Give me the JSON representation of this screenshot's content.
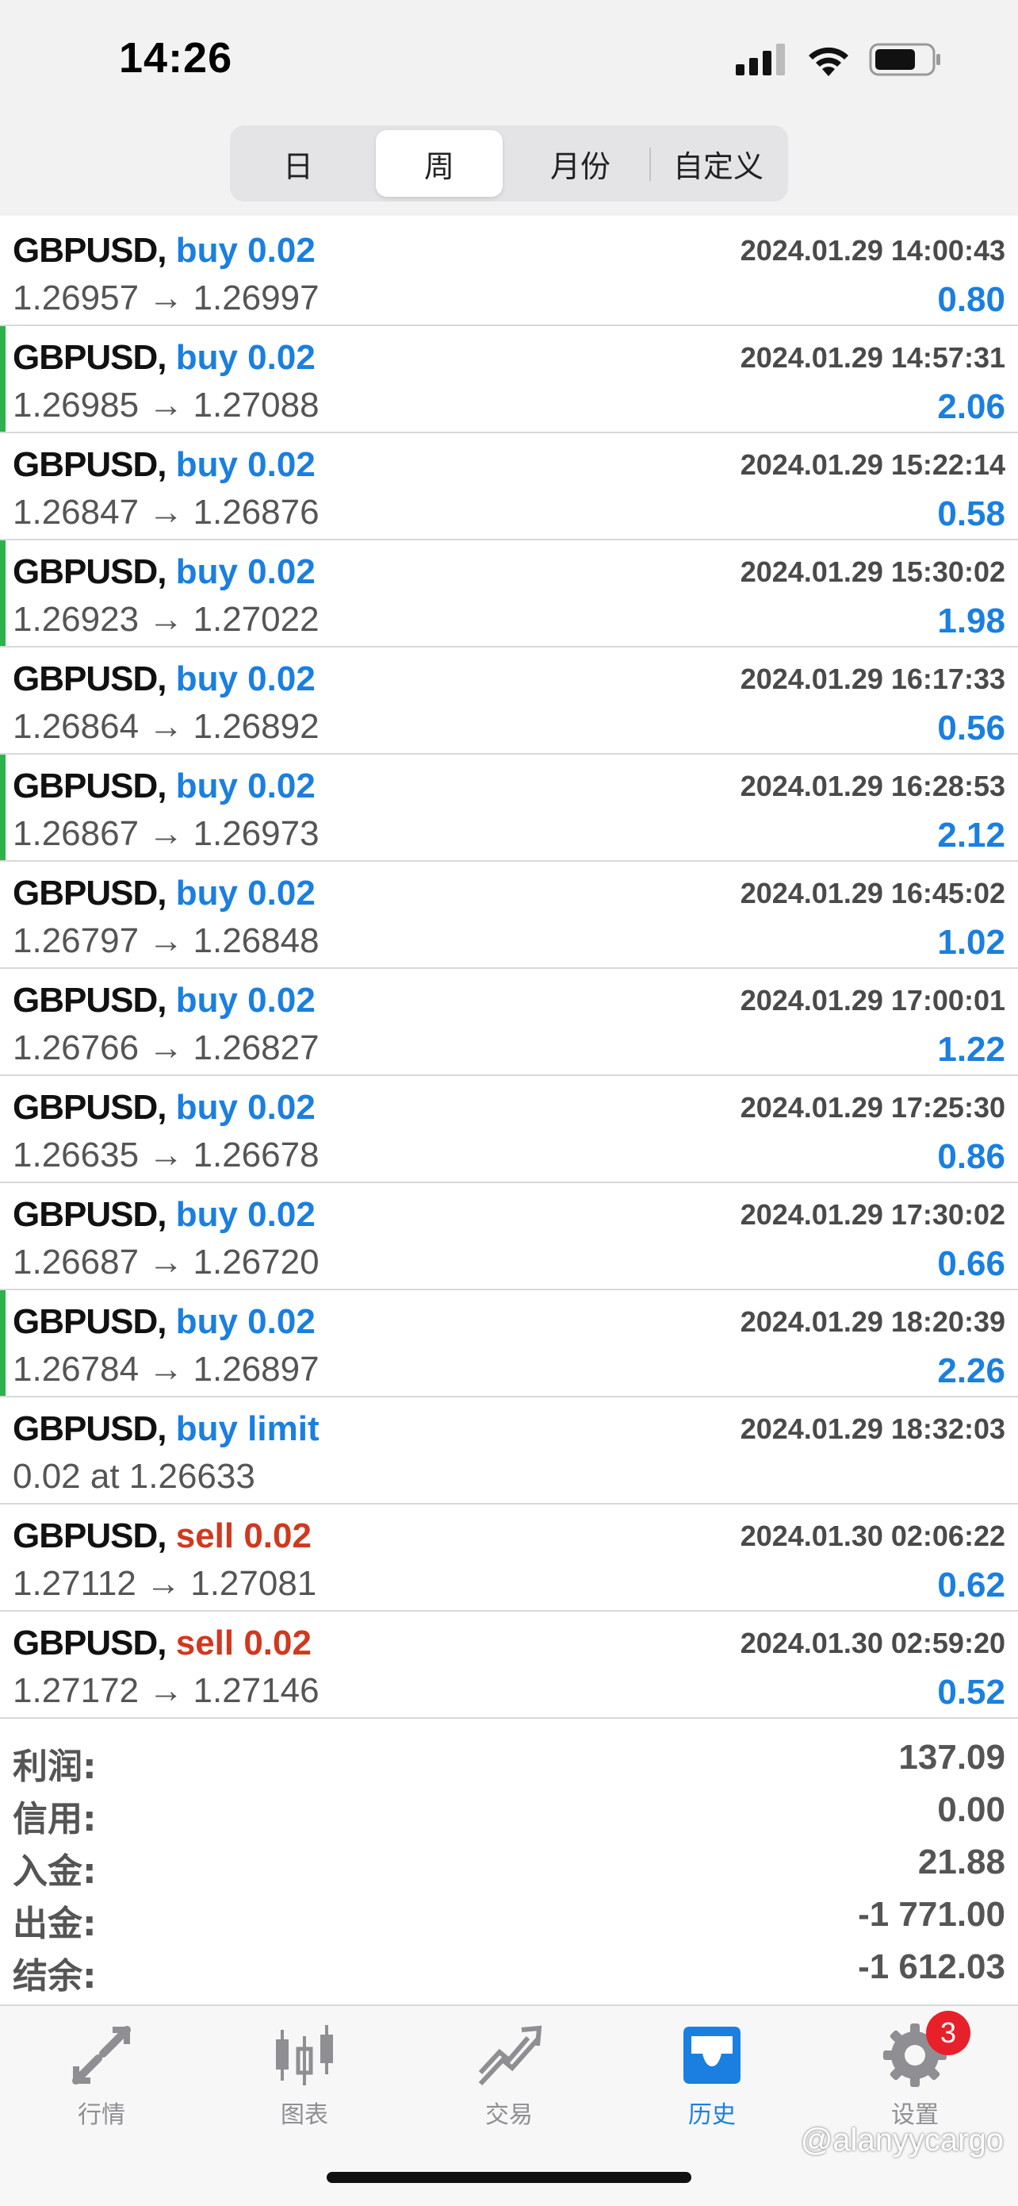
{
  "status": {
    "time": "14:26"
  },
  "period_tabs": [
    {
      "label": "日"
    },
    {
      "label": "周"
    },
    {
      "label": "月份"
    },
    {
      "label": "自定义"
    }
  ],
  "active_period": "周",
  "trades": [
    {
      "symbol": "GBPUSD,",
      "side": "buy",
      "side_text": "buy 0.02",
      "time": "2024.01.29 14:00:43",
      "detail": "1.26957 → 1.26997",
      "profit": "0.80",
      "marker": false
    },
    {
      "symbol": "GBPUSD,",
      "side": "buy",
      "side_text": "buy 0.02",
      "time": "2024.01.29 14:57:31",
      "detail": "1.26985 → 1.27088",
      "profit": "2.06",
      "marker": true
    },
    {
      "symbol": "GBPUSD,",
      "side": "buy",
      "side_text": "buy 0.02",
      "time": "2024.01.29 15:22:14",
      "detail": "1.26847 → 1.26876",
      "profit": "0.58",
      "marker": false
    },
    {
      "symbol": "GBPUSD,",
      "side": "buy",
      "side_text": "buy 0.02",
      "time": "2024.01.29 15:30:02",
      "detail": "1.26923 → 1.27022",
      "profit": "1.98",
      "marker": true
    },
    {
      "symbol": "GBPUSD,",
      "side": "buy",
      "side_text": "buy 0.02",
      "time": "2024.01.29 16:17:33",
      "detail": "1.26864 → 1.26892",
      "profit": "0.56",
      "marker": false
    },
    {
      "symbol": "GBPUSD,",
      "side": "buy",
      "side_text": "buy 0.02",
      "time": "2024.01.29 16:28:53",
      "detail": "1.26867 → 1.26973",
      "profit": "2.12",
      "marker": true
    },
    {
      "symbol": "GBPUSD,",
      "side": "buy",
      "side_text": "buy 0.02",
      "time": "2024.01.29 16:45:02",
      "detail": "1.26797 → 1.26848",
      "profit": "1.02",
      "marker": false
    },
    {
      "symbol": "GBPUSD,",
      "side": "buy",
      "side_text": "buy 0.02",
      "time": "2024.01.29 17:00:01",
      "detail": "1.26766 → 1.26827",
      "profit": "1.22",
      "marker": false
    },
    {
      "symbol": "GBPUSD,",
      "side": "buy",
      "side_text": "buy 0.02",
      "time": "2024.01.29 17:25:30",
      "detail": "1.26635 → 1.26678",
      "profit": "0.86",
      "marker": false
    },
    {
      "symbol": "GBPUSD,",
      "side": "buy",
      "side_text": "buy 0.02",
      "time": "2024.01.29 17:30:02",
      "detail": "1.26687 → 1.26720",
      "profit": "0.66",
      "marker": false
    },
    {
      "symbol": "GBPUSD,",
      "side": "buy",
      "side_text": "buy 0.02",
      "time": "2024.01.29 18:20:39",
      "detail": "1.26784 → 1.26897",
      "profit": "2.26",
      "marker": true
    },
    {
      "symbol": "GBPUSD,",
      "side": "buy",
      "side_text": "buy limit",
      "time": "2024.01.29 18:32:03",
      "detail": "0.02 at 1.26633",
      "profit": "",
      "marker": false
    },
    {
      "symbol": "GBPUSD,",
      "side": "sell",
      "side_text": "sell 0.02",
      "time": "2024.01.30 02:06:22",
      "detail": "1.27112 → 1.27081",
      "profit": "0.62",
      "marker": false
    },
    {
      "symbol": "GBPUSD,",
      "side": "sell",
      "side_text": "sell 0.02",
      "time": "2024.01.30 02:59:20",
      "detail": "1.27172 → 1.27146",
      "profit": "0.52",
      "marker": false
    }
  ],
  "summary": [
    {
      "label": "利润:",
      "value": "137.09"
    },
    {
      "label": "信用:",
      "value": "0.00"
    },
    {
      "label": "入金:",
      "value": "21.88"
    },
    {
      "label": "出金:",
      "value": "-1 771.00"
    },
    {
      "label": "结余:",
      "value": "-1 612.03"
    }
  ],
  "tabbar": {
    "quotes": "行情",
    "charts": "图表",
    "trade": "交易",
    "history": "历史",
    "settings": "设置",
    "settings_badge": "3"
  },
  "watermark": "@alanyycargo",
  "colors": {
    "buy": "#1a7fe0",
    "sell": "#d0391f",
    "profit": "#1a7fe0",
    "marker": "#2fb24c",
    "active_tab": "#1a7fe0",
    "badge": "#e8202a"
  },
  "icons": {
    "status": [
      "cellular-signal-icon",
      "wifi-icon",
      "battery-icon"
    ],
    "tabs": [
      "quotes-arrows-icon",
      "candlestick-chart-icon",
      "trade-trend-icon",
      "history-inbox-icon",
      "settings-gear-icon"
    ]
  }
}
